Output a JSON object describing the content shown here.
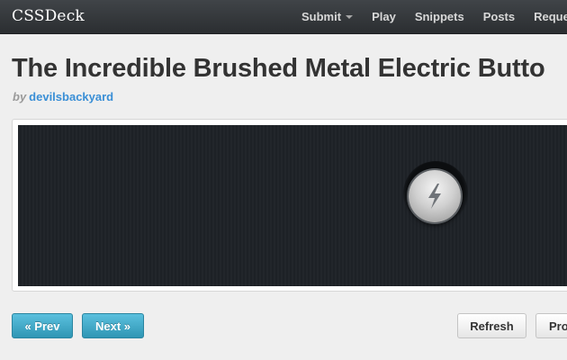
{
  "brand": "CSSDeck",
  "nav": {
    "submit": "Submit",
    "play": "Play",
    "snippets": "Snippets",
    "posts": "Posts",
    "requests": "Reques"
  },
  "title": "The Incredible Brushed Metal Electric Butto",
  "byline": {
    "by": "by",
    "author": "devilsbackyard"
  },
  "buttons": {
    "prev": "« Prev",
    "next": "Next »",
    "refresh": "Refresh",
    "partial": "Pro"
  },
  "icons": {
    "caret": "chevron-down-icon",
    "knob": "lightning-bolt-icon"
  },
  "colors": {
    "accent": "#5bc0de",
    "author_link": "#3a8fd6",
    "stage": "#1d2126"
  }
}
